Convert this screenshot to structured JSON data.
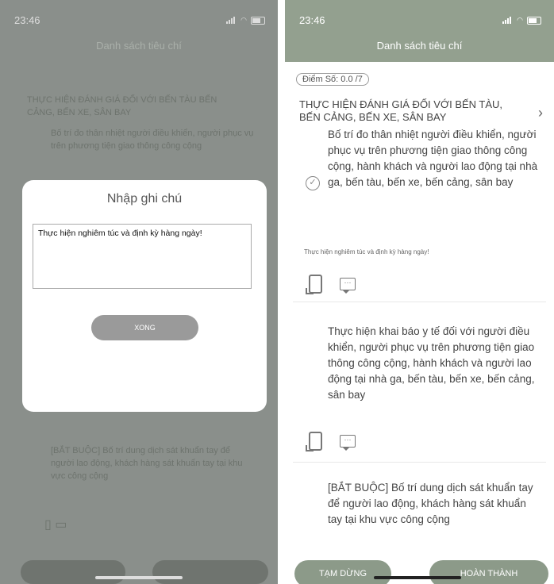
{
  "left": {
    "status_time": "23:46",
    "bg_title": "Danh sách tiêu chí",
    "bg_section": "THỰC HIỆN ĐÁNH GIÁ ĐỐI VỚI BẾN TÀU BẾN CẢNG, BẾN XE, SÂN BAY",
    "bg_crit": "Bố trí đo thân nhiệt người điều khiển, người phục vụ trên phương tiện giao thông công cộng",
    "bg_crit2": "[BẮT BUỘC] Bố trí dung dịch sát khuẩn tay để người lao động, khách hàng sát khuẩn tay tại khu vực công cộng",
    "modal": {
      "title": "Nhập ghi chú",
      "note_value": "Thực hiện nghiêm túc và định kỳ hàng ngày!",
      "done_label": "XONG"
    }
  },
  "right": {
    "status_time": "23:46",
    "title": "Danh sách tiêu chí",
    "score_label": "Điểm Số: 0.0 /7",
    "section_title": "THỰC HIỆN ĐÁNH GIÁ ĐỐI VỚI BẾN TÀU, BẾN CẢNG, BẾN XE, SÂN BAY",
    "criteria": [
      {
        "text": "Bố trí đo thân nhiệt người điều khiển, người phục vụ trên phương tiện giao thông công cộng, hành khách và người lao động tại nhà ga, bến tàu, bến xe, bến cảng, sân bay",
        "checked": true,
        "note": "Thực hiện nghiêm túc và định kỳ hàng ngày!"
      },
      {
        "text": "Thực hiện khai báo y tế đối với người điều khiển, người phục vụ trên phương tiện giao thông công cộng, hành khách và người lao động tại nhà ga, bến tàu, bến xe, bến cảng, sân bay",
        "checked": false
      },
      {
        "text": "[BẮT BUỘC] Bố trí dung dịch sát khuẩn tay để người lao động, khách hàng sát khuẩn tay tại khu vực công cộng",
        "checked": false
      }
    ],
    "pause_label": "TẠM DỪNG",
    "finish_label": "HOÀN THÀNH"
  },
  "colors": {
    "header": "#93a08f",
    "button": "#8c9a89",
    "overlay": "#8a8f8b"
  }
}
